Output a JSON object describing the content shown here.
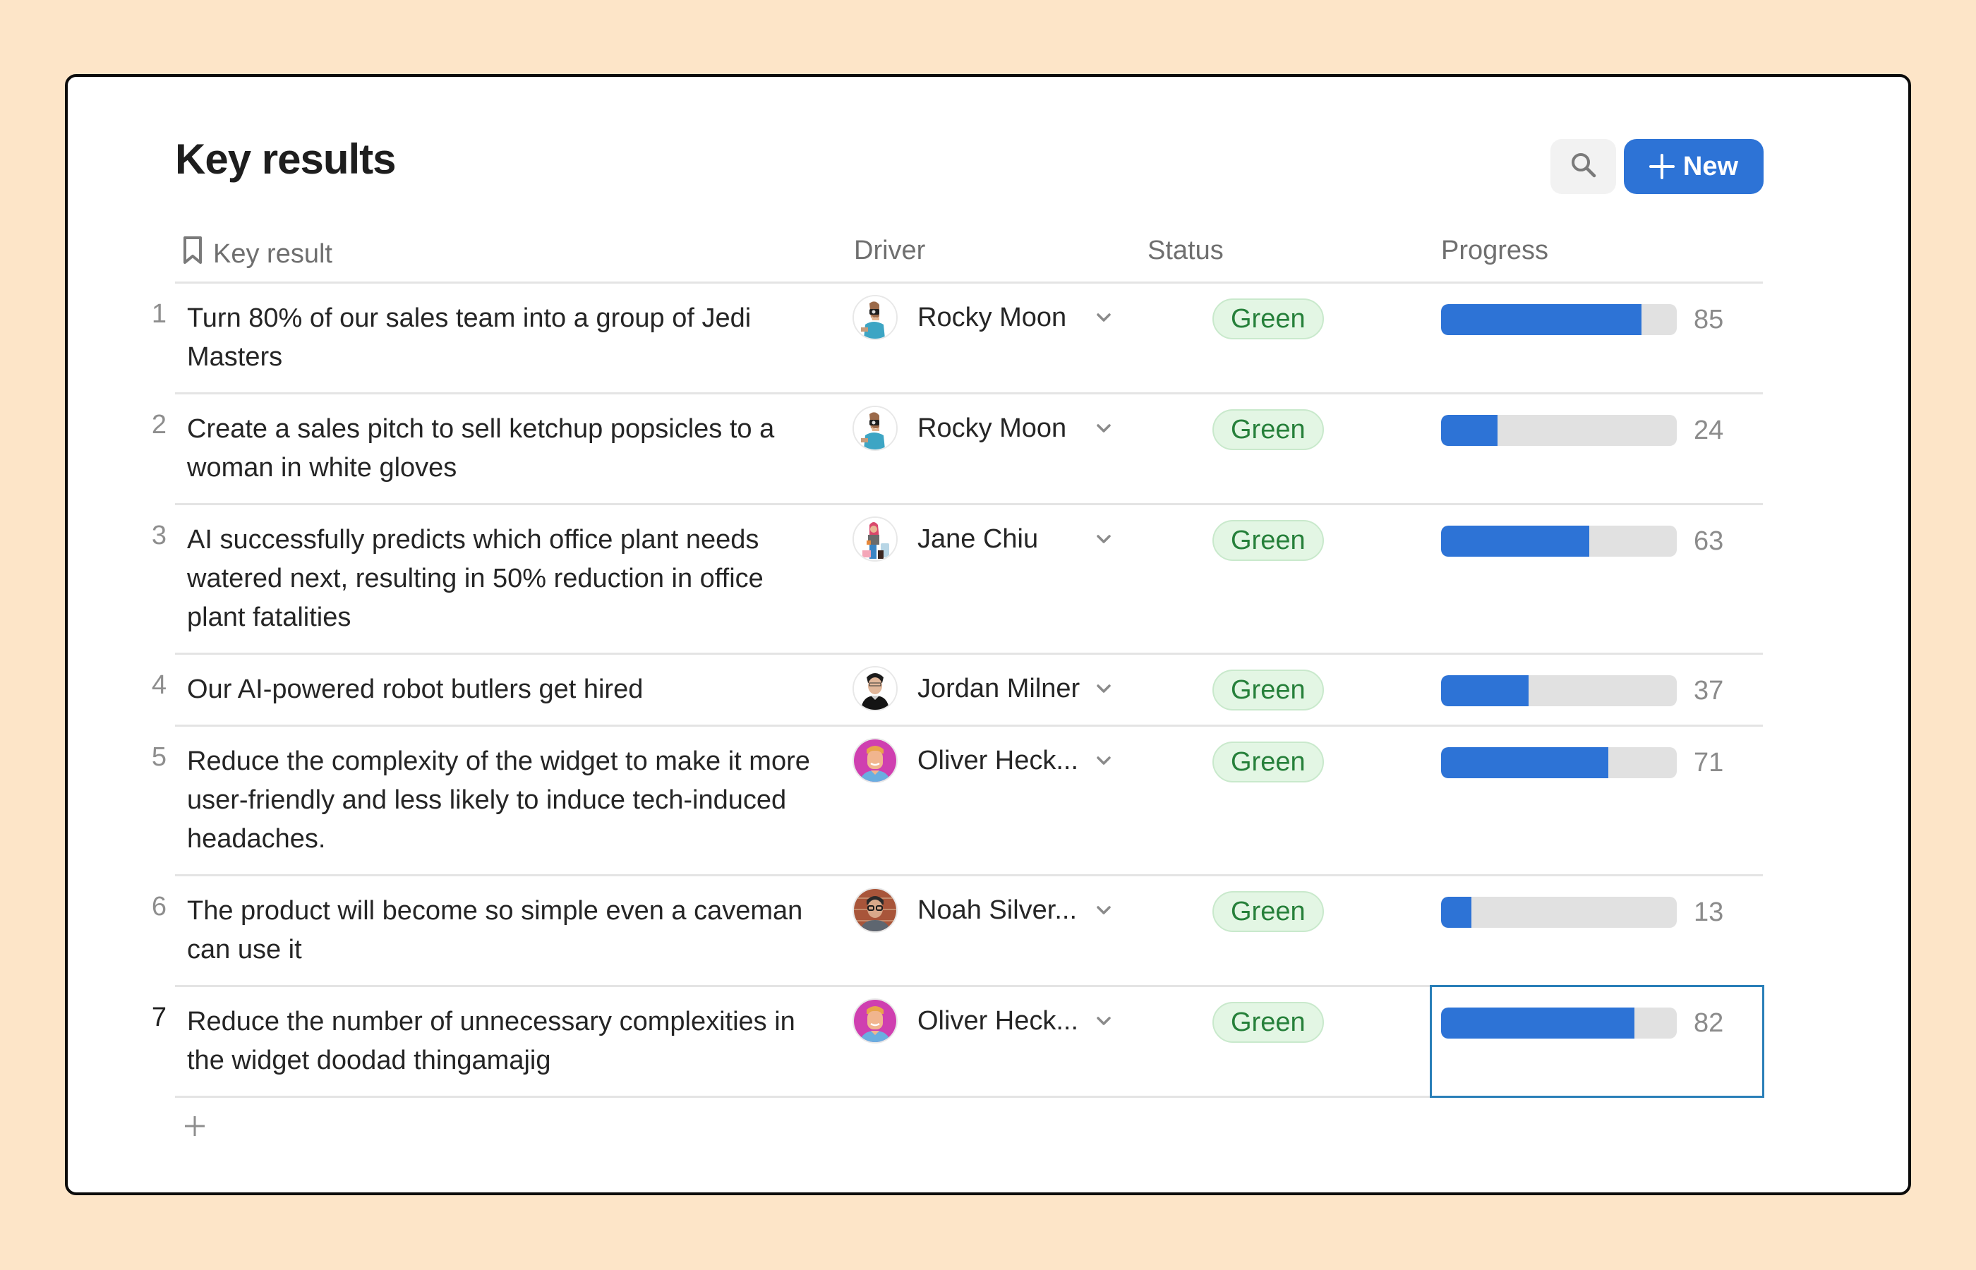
{
  "page": {
    "title": "Key results",
    "colors": {
      "background": "#fde5c8",
      "accent": "#2d73d6",
      "status_green_bg": "#e3f6e4",
      "status_green_text": "#26803a",
      "selection_border": "#2a7fb8"
    }
  },
  "toolbar": {
    "search_icon": "search-icon",
    "new_label": "New",
    "new_icon": "plus-icon"
  },
  "table": {
    "columns": {
      "key_result": "Key result",
      "key_result_icon": "bookmark-icon",
      "driver": "Driver",
      "status": "Status",
      "progress": "Progress"
    },
    "rows": [
      {
        "num": "1",
        "key_result": "Turn 80% of our sales team into a group of Jedi Masters",
        "driver": "Rocky Moon",
        "avatar": "rocky",
        "status": "Green",
        "progress": 85,
        "progress_label": "85"
      },
      {
        "num": "2",
        "key_result": "Create a sales pitch to sell ketchup popsicles to a woman in white gloves",
        "driver": "Rocky Moon",
        "avatar": "rocky",
        "status": "Green",
        "progress": 24,
        "progress_label": "24"
      },
      {
        "num": "3",
        "key_result": "AI successfully predicts which office plant needs watered next, resulting in 50% reduction in office plant fatalities",
        "driver": "Jane Chiu",
        "avatar": "jane",
        "status": "Green",
        "progress": 63,
        "progress_label": "63"
      },
      {
        "num": "4",
        "key_result": "Our AI-powered robot butlers get hired",
        "driver": "Jordan Milner",
        "avatar": "jordan",
        "status": "Green",
        "progress": 37,
        "progress_label": "37"
      },
      {
        "num": "5",
        "key_result": "Reduce the complexity of the widget to make it more user-friendly and less likely to induce tech-induced headaches.",
        "driver": "Oliver Heck...",
        "avatar": "oliver",
        "status": "Green",
        "progress": 71,
        "progress_label": "71"
      },
      {
        "num": "6",
        "key_result": "The product will become so simple even a caveman can use it",
        "driver": "Noah Silver...",
        "avatar": "noah",
        "status": "Green",
        "progress": 13,
        "progress_label": "13"
      },
      {
        "num": "7",
        "key_result": "Reduce the number of unnecessary complexities in the widget doodad thingamajig",
        "driver": "Oliver Heck...",
        "avatar": "oliver",
        "status": "Green",
        "progress": 82,
        "progress_label": "82",
        "active": true
      }
    ],
    "add_row_icon": "plus-icon"
  }
}
